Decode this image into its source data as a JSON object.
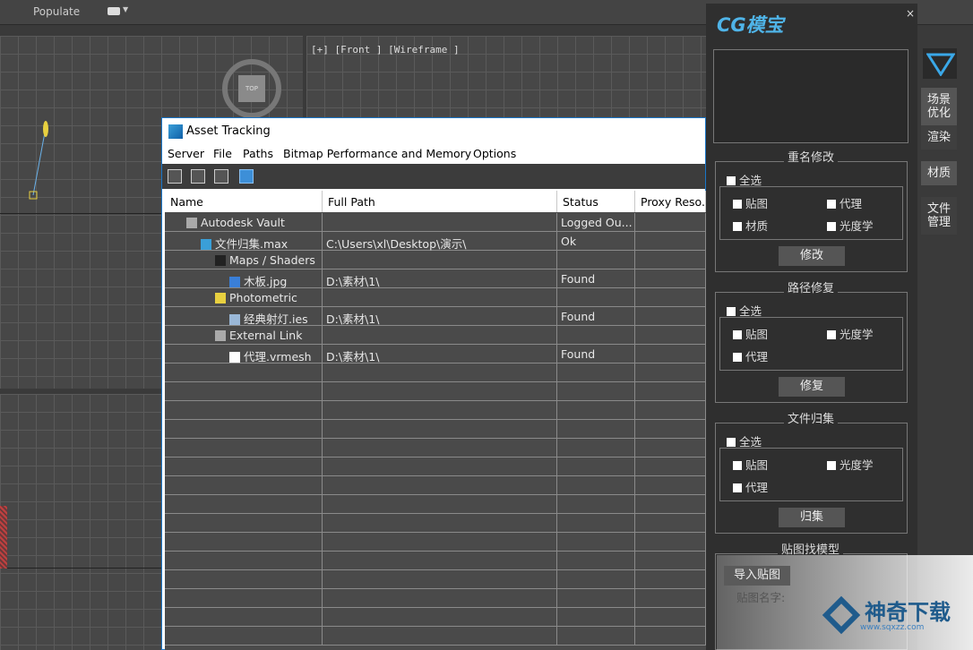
{
  "topbar": {
    "populate_label": "Populate"
  },
  "viewport": {
    "label": "[+] [Front ] [Wireframe ]",
    "cube_label": "TOP"
  },
  "asset_tracking": {
    "title": "Asset Tracking",
    "menu": [
      "Server",
      "File",
      "Paths",
      "Bitmap Performance and Memory",
      "Options"
    ],
    "columns": [
      "Name",
      "Full Path",
      "Status",
      "Proxy Reso..."
    ],
    "rows": [
      {
        "name": "Autodesk Vault",
        "path": "",
        "status": "Logged Ou...",
        "proxy": "",
        "icon": "vault-icon",
        "indent": 1
      },
      {
        "name": "文件归集.max",
        "path": "C:\\Users\\xl\\Desktop\\演示\\",
        "status": "Ok",
        "proxy": "",
        "icon": "max-file-icon",
        "indent": 2
      },
      {
        "name": "Maps / Shaders",
        "path": "",
        "status": "",
        "proxy": "",
        "icon": "maps-icon",
        "indent": 3
      },
      {
        "name": "木板.jpg",
        "path": "D:\\素材\\1\\",
        "status": "Found",
        "proxy": "",
        "icon": "image-file-icon",
        "indent": 4
      },
      {
        "name": "Photometric",
        "path": "",
        "status": "",
        "proxy": "",
        "icon": "photometric-icon",
        "indent": 3
      },
      {
        "name": "经典射灯.ies",
        "path": "D:\\素材\\1\\",
        "status": "Found",
        "proxy": "",
        "icon": "ies-file-icon",
        "indent": 4
      },
      {
        "name": "External Link",
        "path": "",
        "status": "",
        "proxy": "",
        "icon": "link-icon",
        "indent": 3
      },
      {
        "name": "代理.vrmesh",
        "path": "D:\\素材\\1\\",
        "status": "Found",
        "proxy": "",
        "icon": "document-icon",
        "indent": 4
      }
    ]
  },
  "cg_panel": {
    "logo": "CG模宝",
    "close": "×",
    "rename": {
      "title": "重名修改",
      "select_all": "全选",
      "options": [
        "贴图",
        "代理",
        "材质",
        "光度学"
      ],
      "button": "修改"
    },
    "path_fix": {
      "title": "路径修复",
      "select_all": "全选",
      "options": [
        "贴图",
        "光度学",
        "代理"
      ],
      "button": "修复"
    },
    "collect": {
      "title": "文件归集",
      "select_all": "全选",
      "options": [
        "贴图",
        "光度学",
        "代理"
      ],
      "button": "归集"
    },
    "find_model": {
      "title": "贴图找模型",
      "import_button": "导入贴图",
      "name_label": "贴图名字:"
    }
  },
  "right_tabs": [
    "场景\n优化",
    "渲染",
    "材质",
    "文件\n管理"
  ],
  "watermark": {
    "text": "神奇下载",
    "sub": "www.sqxzz.com"
  }
}
